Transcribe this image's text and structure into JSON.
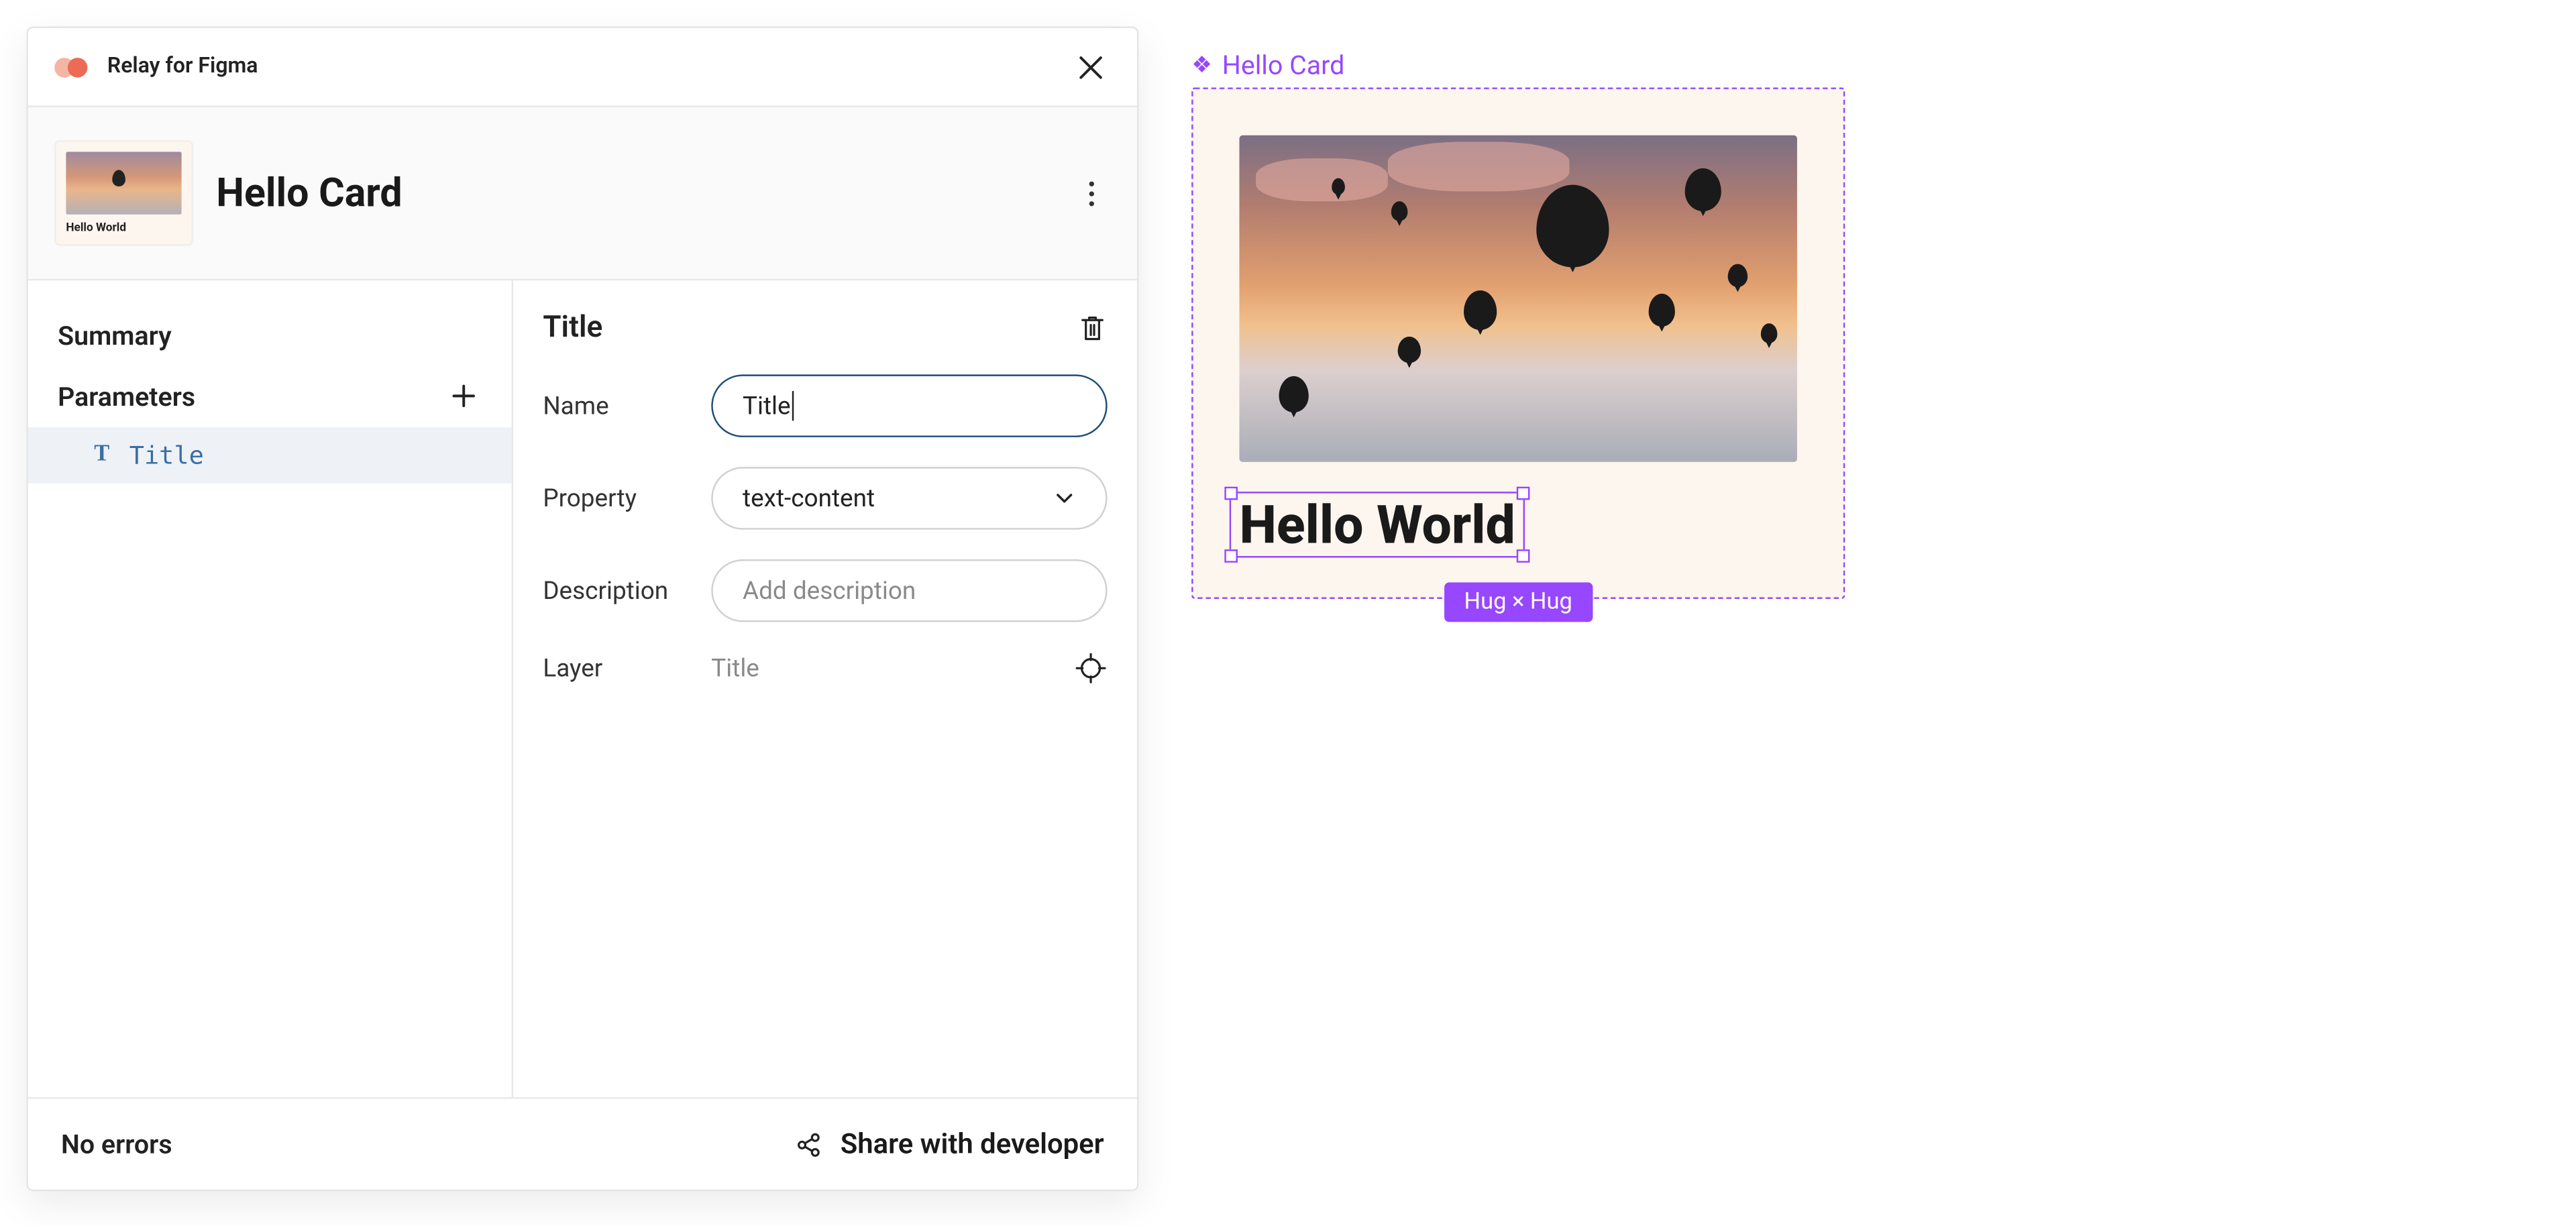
{
  "plugin": {
    "title": "Relay for Figma",
    "component_name": "Hello Card",
    "thumb_caption": "Hello World"
  },
  "sidebar": {
    "summary_label": "Summary",
    "parameters_label": "Parameters",
    "items": [
      {
        "name": "Title"
      }
    ]
  },
  "detail": {
    "heading": "Title",
    "fields": {
      "name_label": "Name",
      "name_value": "Title",
      "property_label": "Property",
      "property_value": "text-content",
      "description_label": "Description",
      "description_placeholder": "Add description",
      "layer_label": "Layer",
      "layer_value": "Title"
    }
  },
  "footer": {
    "errors": "No errors",
    "share_label": "Share with developer"
  },
  "canvas": {
    "frame_name": "Hello Card",
    "card_title": "Hello World",
    "size_badge": "Hug × Hug"
  }
}
